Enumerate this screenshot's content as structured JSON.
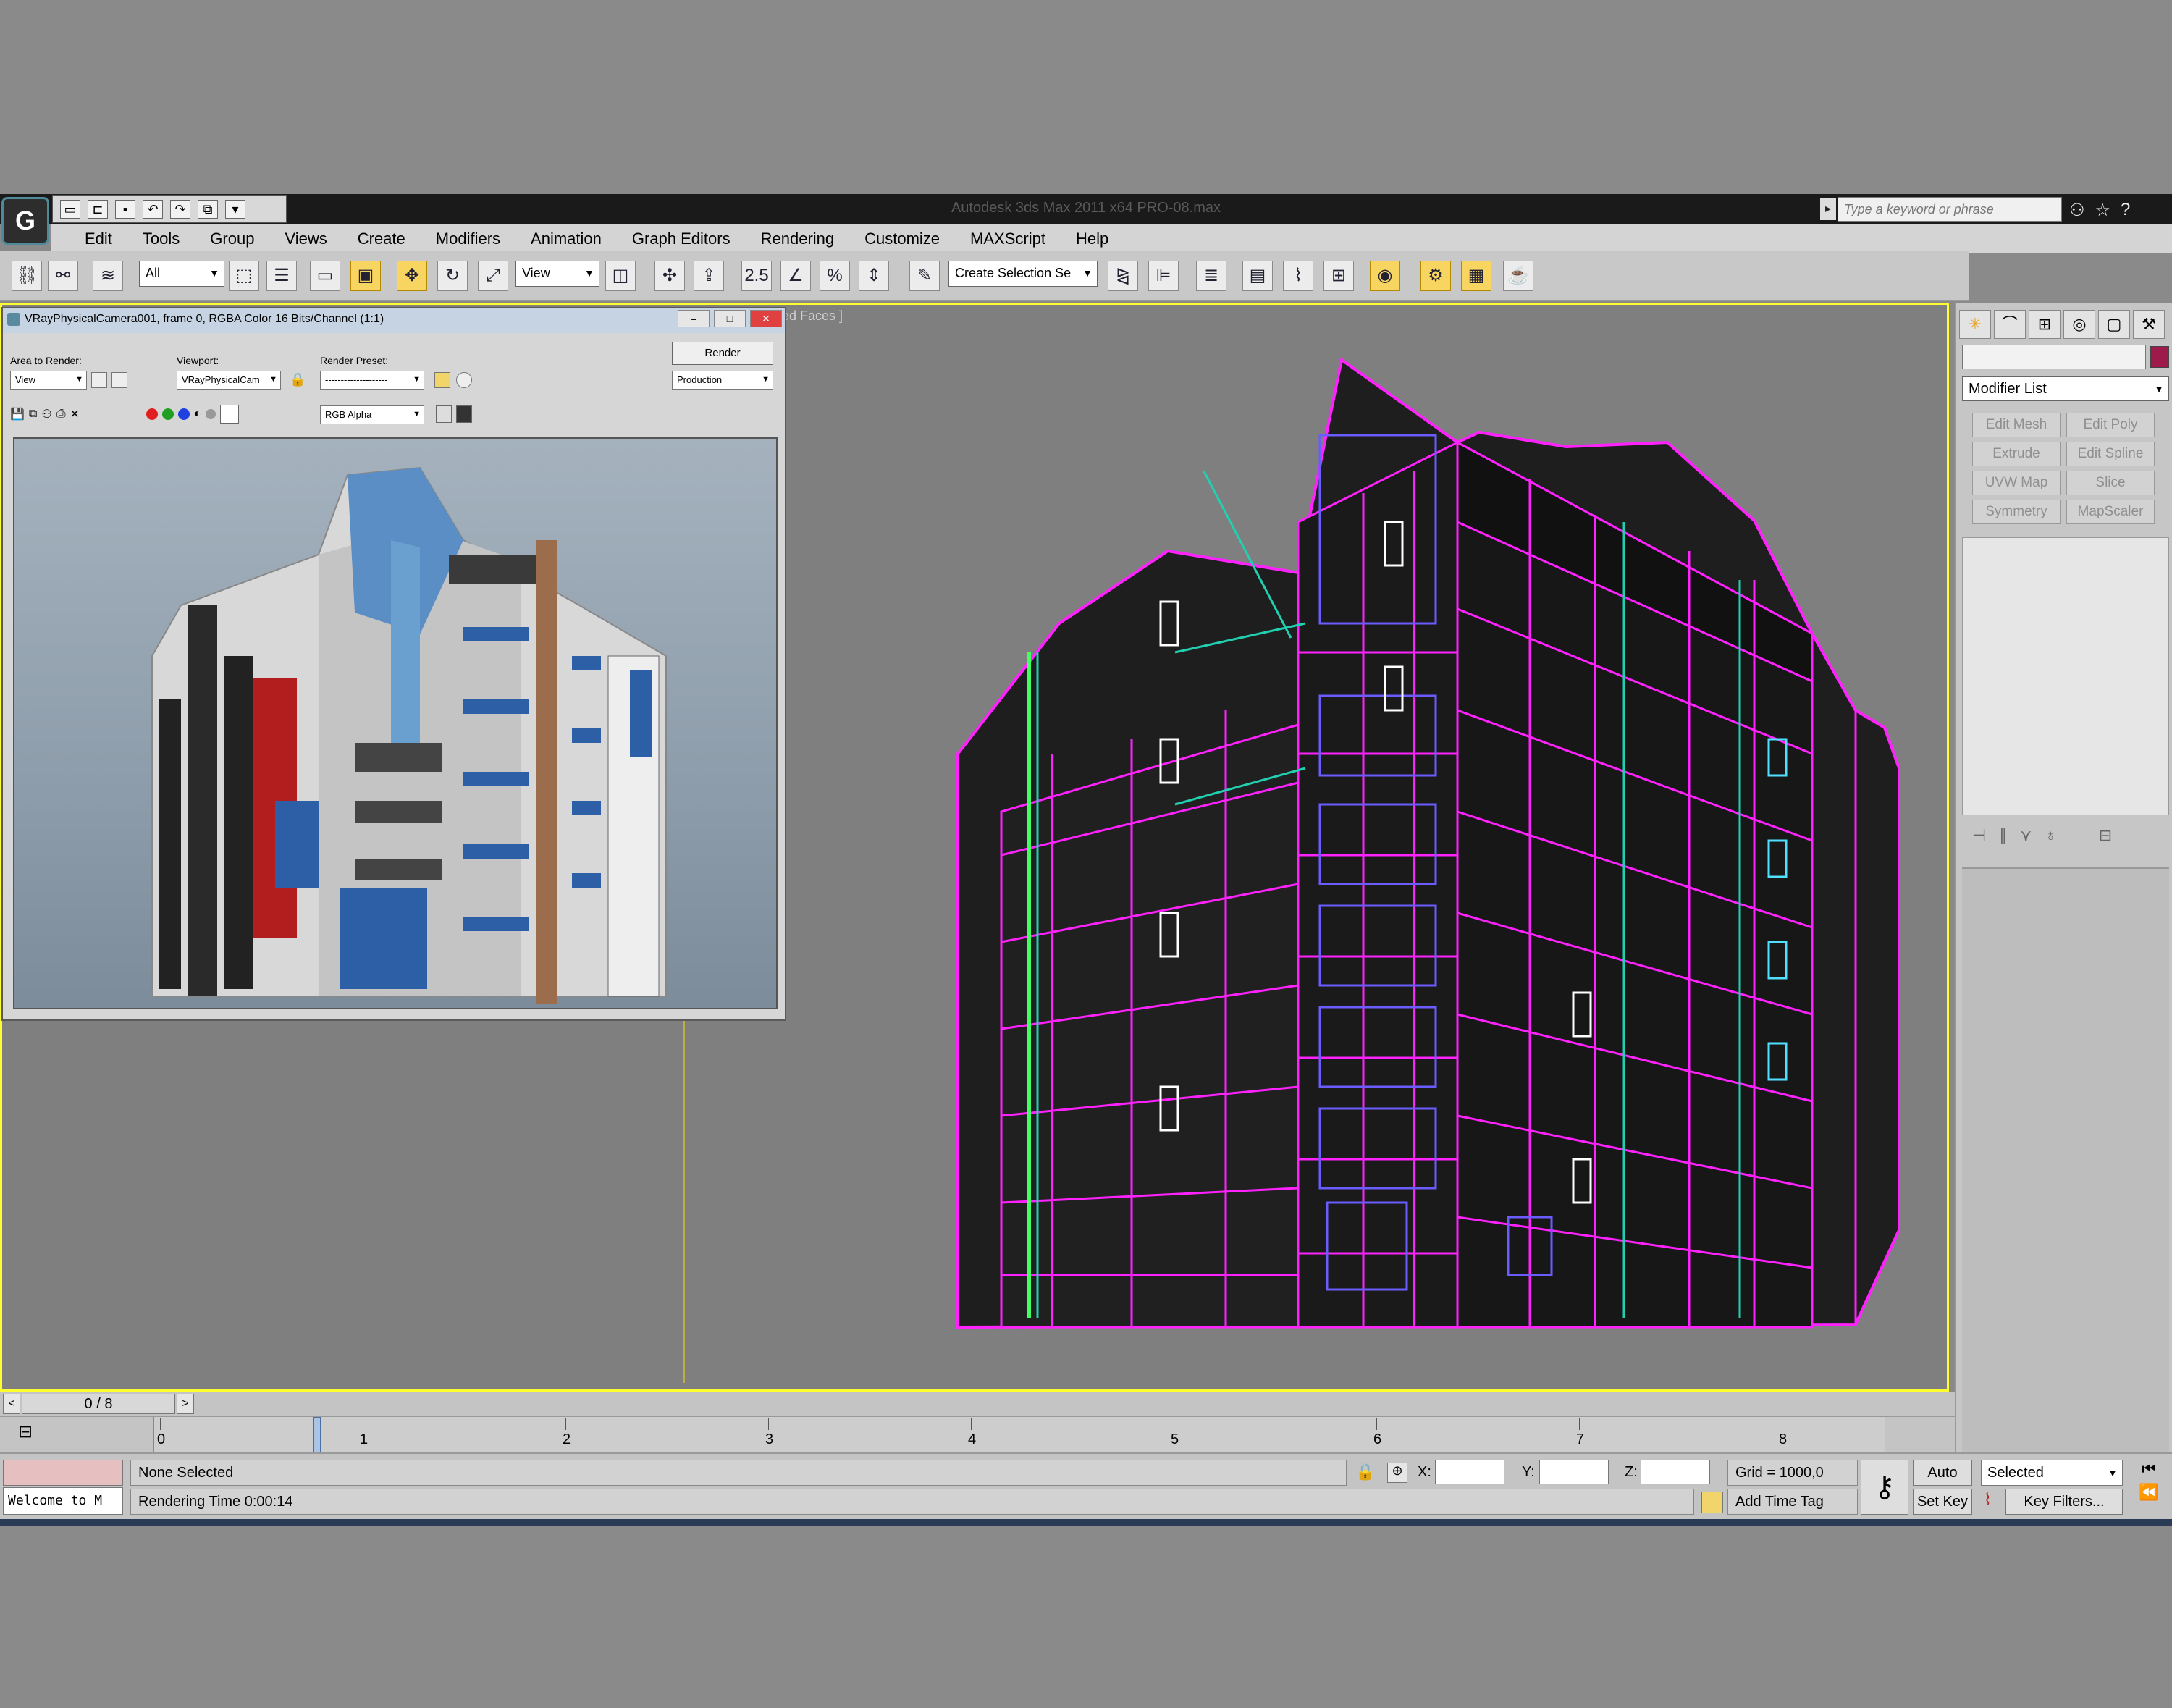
{
  "window": {
    "title": "Autodesk 3ds Max  2011 x64      PRO-08.max",
    "search_placeholder": "Type a keyword or phrase"
  },
  "menu": [
    "Edit",
    "Tools",
    "Group",
    "Views",
    "Create",
    "Modifiers",
    "Animation",
    "Graph Editors",
    "Rendering",
    "Customize",
    "MAXScript",
    "Help"
  ],
  "toolbar": {
    "selection_filter": "All",
    "reference_coord": "View",
    "named_selection": "Create Selection Se"
  },
  "viewport": {
    "label": "ged Faces ]"
  },
  "vfb": {
    "title": "VRayPhysicalCamera001, frame 0, RGBA Color 16 Bits/Channel (1:1)",
    "area_to_render_label": "Area to Render:",
    "area_to_render_value": "View",
    "viewport_label": "Viewport:",
    "viewport_value": "VRayPhysicalCam",
    "render_preset_label": "Render Preset:",
    "render_preset_value": "--------------------",
    "render_button": "Render",
    "production_value": "Production",
    "channel_value": "RGB Alpha"
  },
  "command_panel": {
    "modifier_list": "Modifier List",
    "object_color": "#9e1a4a",
    "modifier_buttons": [
      "Edit Mesh",
      "Edit Poly",
      "Extrude",
      "Edit Spline",
      "UVW Map",
      "Slice",
      "Symmetry",
      "MapScaler"
    ]
  },
  "time_slider": {
    "position": "0 / 8",
    "prev": "<",
    "next": ">",
    "ticks": [
      "0",
      "1",
      "2",
      "3",
      "4",
      "5",
      "6",
      "7",
      "8"
    ]
  },
  "status": {
    "selection": "None Selected",
    "render_time": "Rendering Time  0:00:14",
    "listener": "Welcome to M",
    "x_label": "X:",
    "y_label": "Y:",
    "z_label": "Z:",
    "grid": "Grid = 1000,0",
    "add_time_tag": "Add Time Tag",
    "auto_key": "Auto Key",
    "set_key": "Set Key",
    "key_mode": "Selected",
    "key_filters": "Key Filters..."
  }
}
